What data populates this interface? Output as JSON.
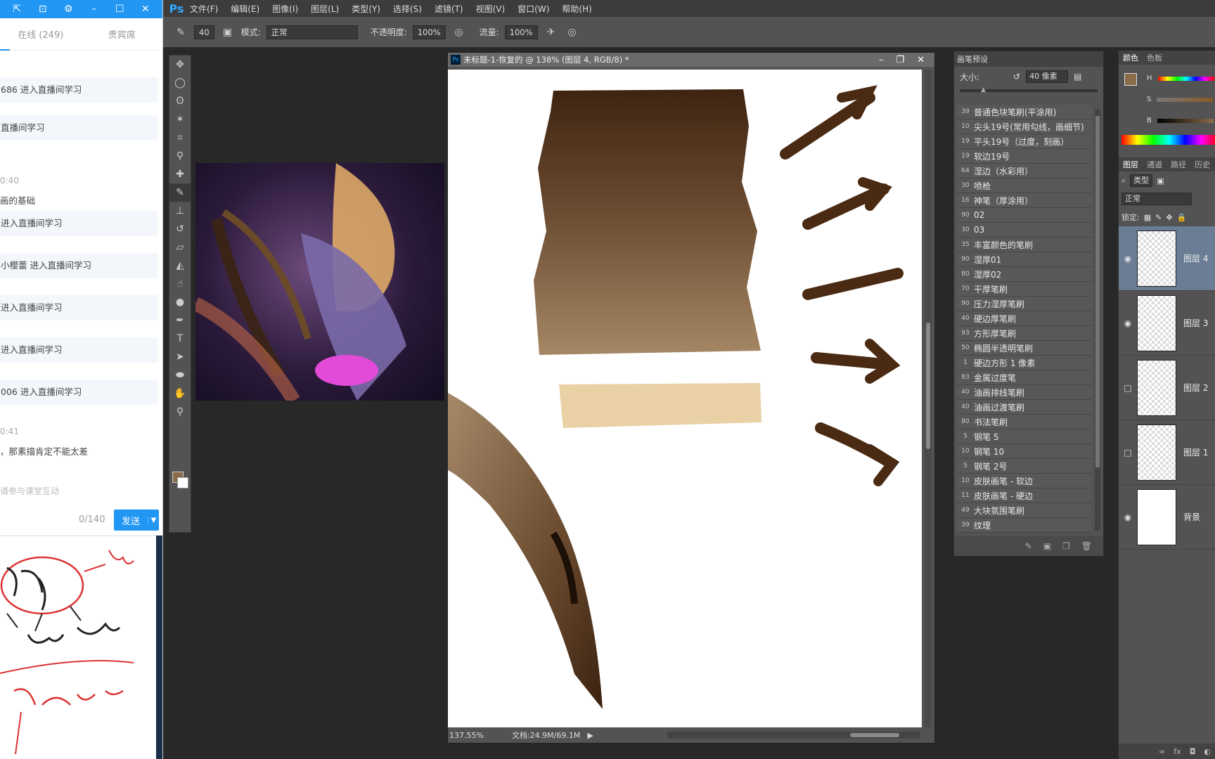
{
  "chat": {
    "tabs": [
      "在线 (249)",
      "贵宾席"
    ],
    "messages": [
      "686 进入直播间学习",
      "直播间学习",
      "进入直播间学习",
      "小樱蕾 进入直播间学习",
      "进入直播间学习",
      "进入直播间学习",
      "006 进入直播间学习"
    ],
    "time1": "0:40",
    "line1": "画的基础",
    "time2": "0:41",
    "line2": "，那素描肯定不能太差",
    "input_placeholder": "请参与课堂互动",
    "char_count": "0/140",
    "send_label": "发送"
  },
  "ps": {
    "logo": "Ps",
    "menu": [
      "文件(F)",
      "编辑(E)",
      "图像(I)",
      "图层(L)",
      "类型(Y)",
      "选择(S)",
      "滤镜(T)",
      "视图(V)",
      "窗口(W)",
      "帮助(H)"
    ],
    "options": {
      "brush_size": "40",
      "mode_label": "模式:",
      "mode_value": "正常",
      "opacity_label": "不透明度:",
      "opacity_value": "100%",
      "flow_label": "流量:",
      "flow_value": "100%"
    },
    "document": {
      "title": "未标题-1-恢复的 @ 138% (图层 4, RGB/8) *",
      "zoom": "137.55%",
      "doc_size": "文档:24.9M/69.1M"
    }
  },
  "brush_panel": {
    "title": "画笔预设",
    "size_label": "大小:",
    "size_value": "40 像素",
    "brushes": [
      {
        "size": "39",
        "name": "普通色块笔刷(平涂用)"
      },
      {
        "size": "10",
        "name": "尖头19号(常用勾线，画细节)"
      },
      {
        "size": "19",
        "name": "平头19号（过度，刻画）"
      },
      {
        "size": "19",
        "name": "软边19号"
      },
      {
        "size": "64",
        "name": "湿边（水彩用）"
      },
      {
        "size": "30",
        "name": "喷枪"
      },
      {
        "size": "16",
        "name": "神笔（厚涂用）"
      },
      {
        "size": "90",
        "name": "02"
      },
      {
        "size": "30",
        "name": "03"
      },
      {
        "size": "35",
        "name": "丰富颜色的笔刷"
      },
      {
        "size": "90",
        "name": "湿厚01"
      },
      {
        "size": "80",
        "name": "湿厚02"
      },
      {
        "size": "70",
        "name": "干厚笔刷"
      },
      {
        "size": "90",
        "name": "压力湿厚笔刷"
      },
      {
        "size": "40",
        "name": "硬边厚笔刷"
      },
      {
        "size": "93",
        "name": "方形厚笔刷"
      },
      {
        "size": "50",
        "name": "椭圆半透明笔刷"
      },
      {
        "size": "1",
        "name": "硬边方形 1 像素"
      },
      {
        "size": "83",
        "name": "金属过度笔"
      },
      {
        "size": "40",
        "name": "油画排线笔刷"
      },
      {
        "size": "40",
        "name": "油画过渡笔刷"
      },
      {
        "size": "80",
        "name": "书法笔刷"
      },
      {
        "size": "5",
        "name": "钢笔 5"
      },
      {
        "size": "10",
        "name": "钢笔 10"
      },
      {
        "size": "5",
        "name": "钢笔 2号"
      },
      {
        "size": "10",
        "name": "皮肤画笔 - 软边"
      },
      {
        "size": "11",
        "name": "皮肤画笔 - 硬边"
      },
      {
        "size": "49",
        "name": "大块氛围笔刷"
      },
      {
        "size": "39",
        "name": "纹理"
      }
    ]
  },
  "right_panel": {
    "color_tabs": [
      "颜色",
      "色板"
    ],
    "hsb": [
      "H",
      "S",
      "B"
    ],
    "layer_tabs": [
      "图层",
      "通道",
      "路径",
      "历史"
    ],
    "kind_label": "类型",
    "blend_mode": "正常",
    "lock_label": "锁定:",
    "layers": [
      {
        "name": "图层 4",
        "selected": true,
        "visible": true
      },
      {
        "name": "图层 3",
        "selected": false,
        "visible": true
      },
      {
        "name": "图层 2",
        "selected": false,
        "visible": false
      },
      {
        "name": "图层 1",
        "selected": false,
        "visible": false
      },
      {
        "name": "背景",
        "selected": false,
        "visible": true
      }
    ]
  },
  "colors": {
    "foreground": "#8a6b4a",
    "background": "#ffffff",
    "accent_blue": "#2196f3",
    "ps_ui": "#535353"
  }
}
